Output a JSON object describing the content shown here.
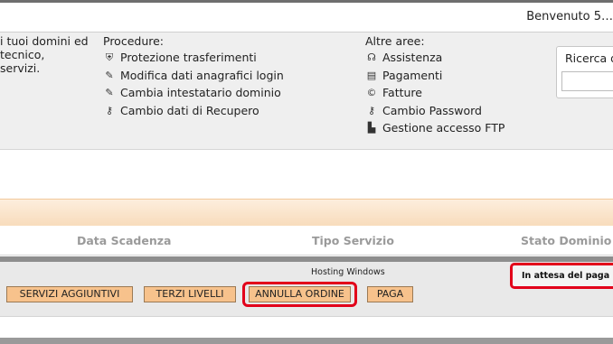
{
  "header": {
    "welcome_text": "Benvenuto 5…"
  },
  "intro": {
    "line1": "i tuoi domini ed",
    "line2": "tecnico,",
    "line3": "servizi."
  },
  "procedures": {
    "title": "Procedure:",
    "items": [
      {
        "label": "Protezione trasferimenti",
        "icon": "shield-icon"
      },
      {
        "label": "Modifica dati anagrafici login",
        "icon": "edit-icon"
      },
      {
        "label": "Cambia intestatario dominio",
        "icon": "edit-icon"
      },
      {
        "label": "Cambio dati di Recupero",
        "icon": "key-icon"
      }
    ]
  },
  "other_areas": {
    "title": "Altre aree:",
    "items": [
      {
        "label": "Assistenza",
        "icon": "headset-icon"
      },
      {
        "label": "Pagamenti",
        "icon": "payment-icon"
      },
      {
        "label": "Fatture",
        "icon": "invoice-icon"
      },
      {
        "label": "Cambio Password",
        "icon": "key-icon"
      },
      {
        "label": "Gestione accesso FTP",
        "icon": "ftp-icon"
      }
    ]
  },
  "search": {
    "label": "Ricerca d",
    "placeholder": ""
  },
  "table": {
    "columns": [
      "Data Scadenza",
      "Tipo Servizio",
      "Stato Dominio"
    ],
    "row": {
      "service_type": "Hosting Windows",
      "status": "In attesa del paga",
      "buttons": {
        "extra_services": "SERVIZI AGGIUNTIVI",
        "third_levels": "TERZI LIVELLI",
        "cancel_order": "ANNULLA ORDINE",
        "pay": "PAGA"
      }
    }
  },
  "colors": {
    "highlight": "#e2001a",
    "button_bg": "#f7c28c",
    "panel_bg": "#efefef"
  }
}
